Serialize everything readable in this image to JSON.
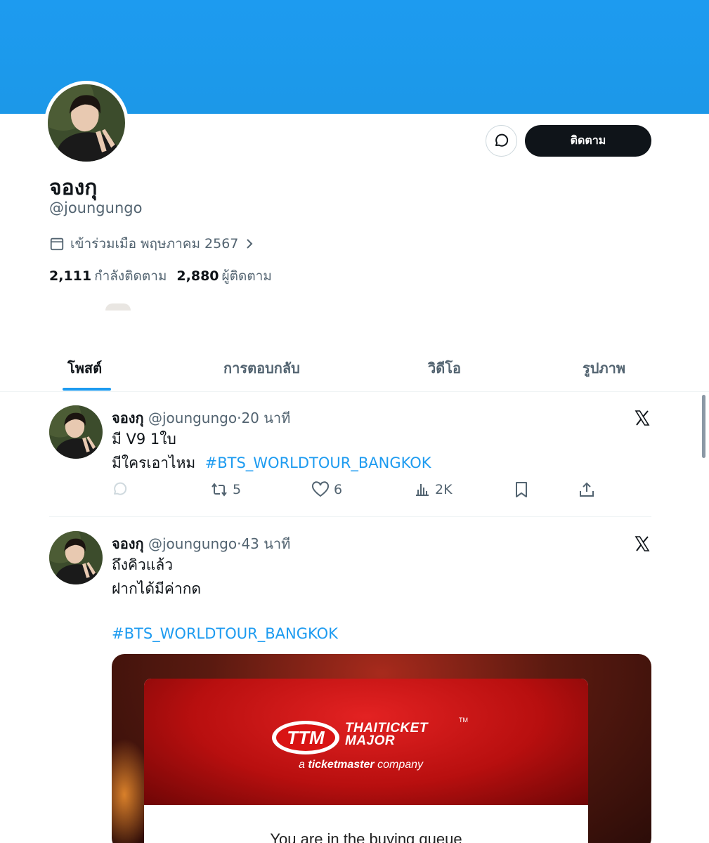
{
  "profile": {
    "display_name": "จองกุ",
    "handle": "@joungungo",
    "joined": "เข้าร่วมเมือ พฤษภาคม 2567",
    "following_count": "2,111",
    "following_label": "กำลังติดตาม",
    "followers_count": "2,880",
    "followers_label": "ผู้ติดตาม",
    "follow_button": "ติดตาม"
  },
  "tabs": [
    {
      "label": "โพสต์",
      "active": true
    },
    {
      "label": "การตอบกลับ",
      "active": false
    },
    {
      "label": "วิดีโอ",
      "active": false
    },
    {
      "label": "รูปภาพ",
      "active": false
    }
  ],
  "tweets": [
    {
      "name": "จองกุ",
      "handle": "@joungungo",
      "time": "20 นาที",
      "lines": [
        "มี V9 1ใบ",
        "มีใครเอาไหม"
      ],
      "hashtag": "#BTS_WORLDTOUR_BANGKOK",
      "retweets": "5",
      "likes": "6",
      "views": "2K"
    },
    {
      "name": "จองกุ",
      "handle": "@joungungo",
      "time": "43 นาที",
      "lines": [
        "ถึงคิวแล้ว",
        "ฝากได้มีค่ากด"
      ],
      "hashtag": "#BTS_WORLDTOUR_BANGKOK",
      "media": {
        "brand": "THAITICKET MAJOR",
        "brand_line1": "THAITICKET",
        "brand_line2": "MAJOR",
        "tm": "TM",
        "sub_pre": "a",
        "sub_bold": "ticketmaster",
        "sub_post": "company",
        "queue_text": "You are in the buying queue"
      }
    }
  ],
  "colors": {
    "banner": "#1d9bf0",
    "accent": "#1d9bf0",
    "text": "#0f1419",
    "muted": "#536471"
  },
  "icons": [
    "calendar-icon",
    "chevron-right-icon",
    "message-icon",
    "x-logo-icon",
    "reply-icon",
    "retweet-icon",
    "like-icon",
    "views-icon",
    "bookmark-icon",
    "share-icon"
  ]
}
